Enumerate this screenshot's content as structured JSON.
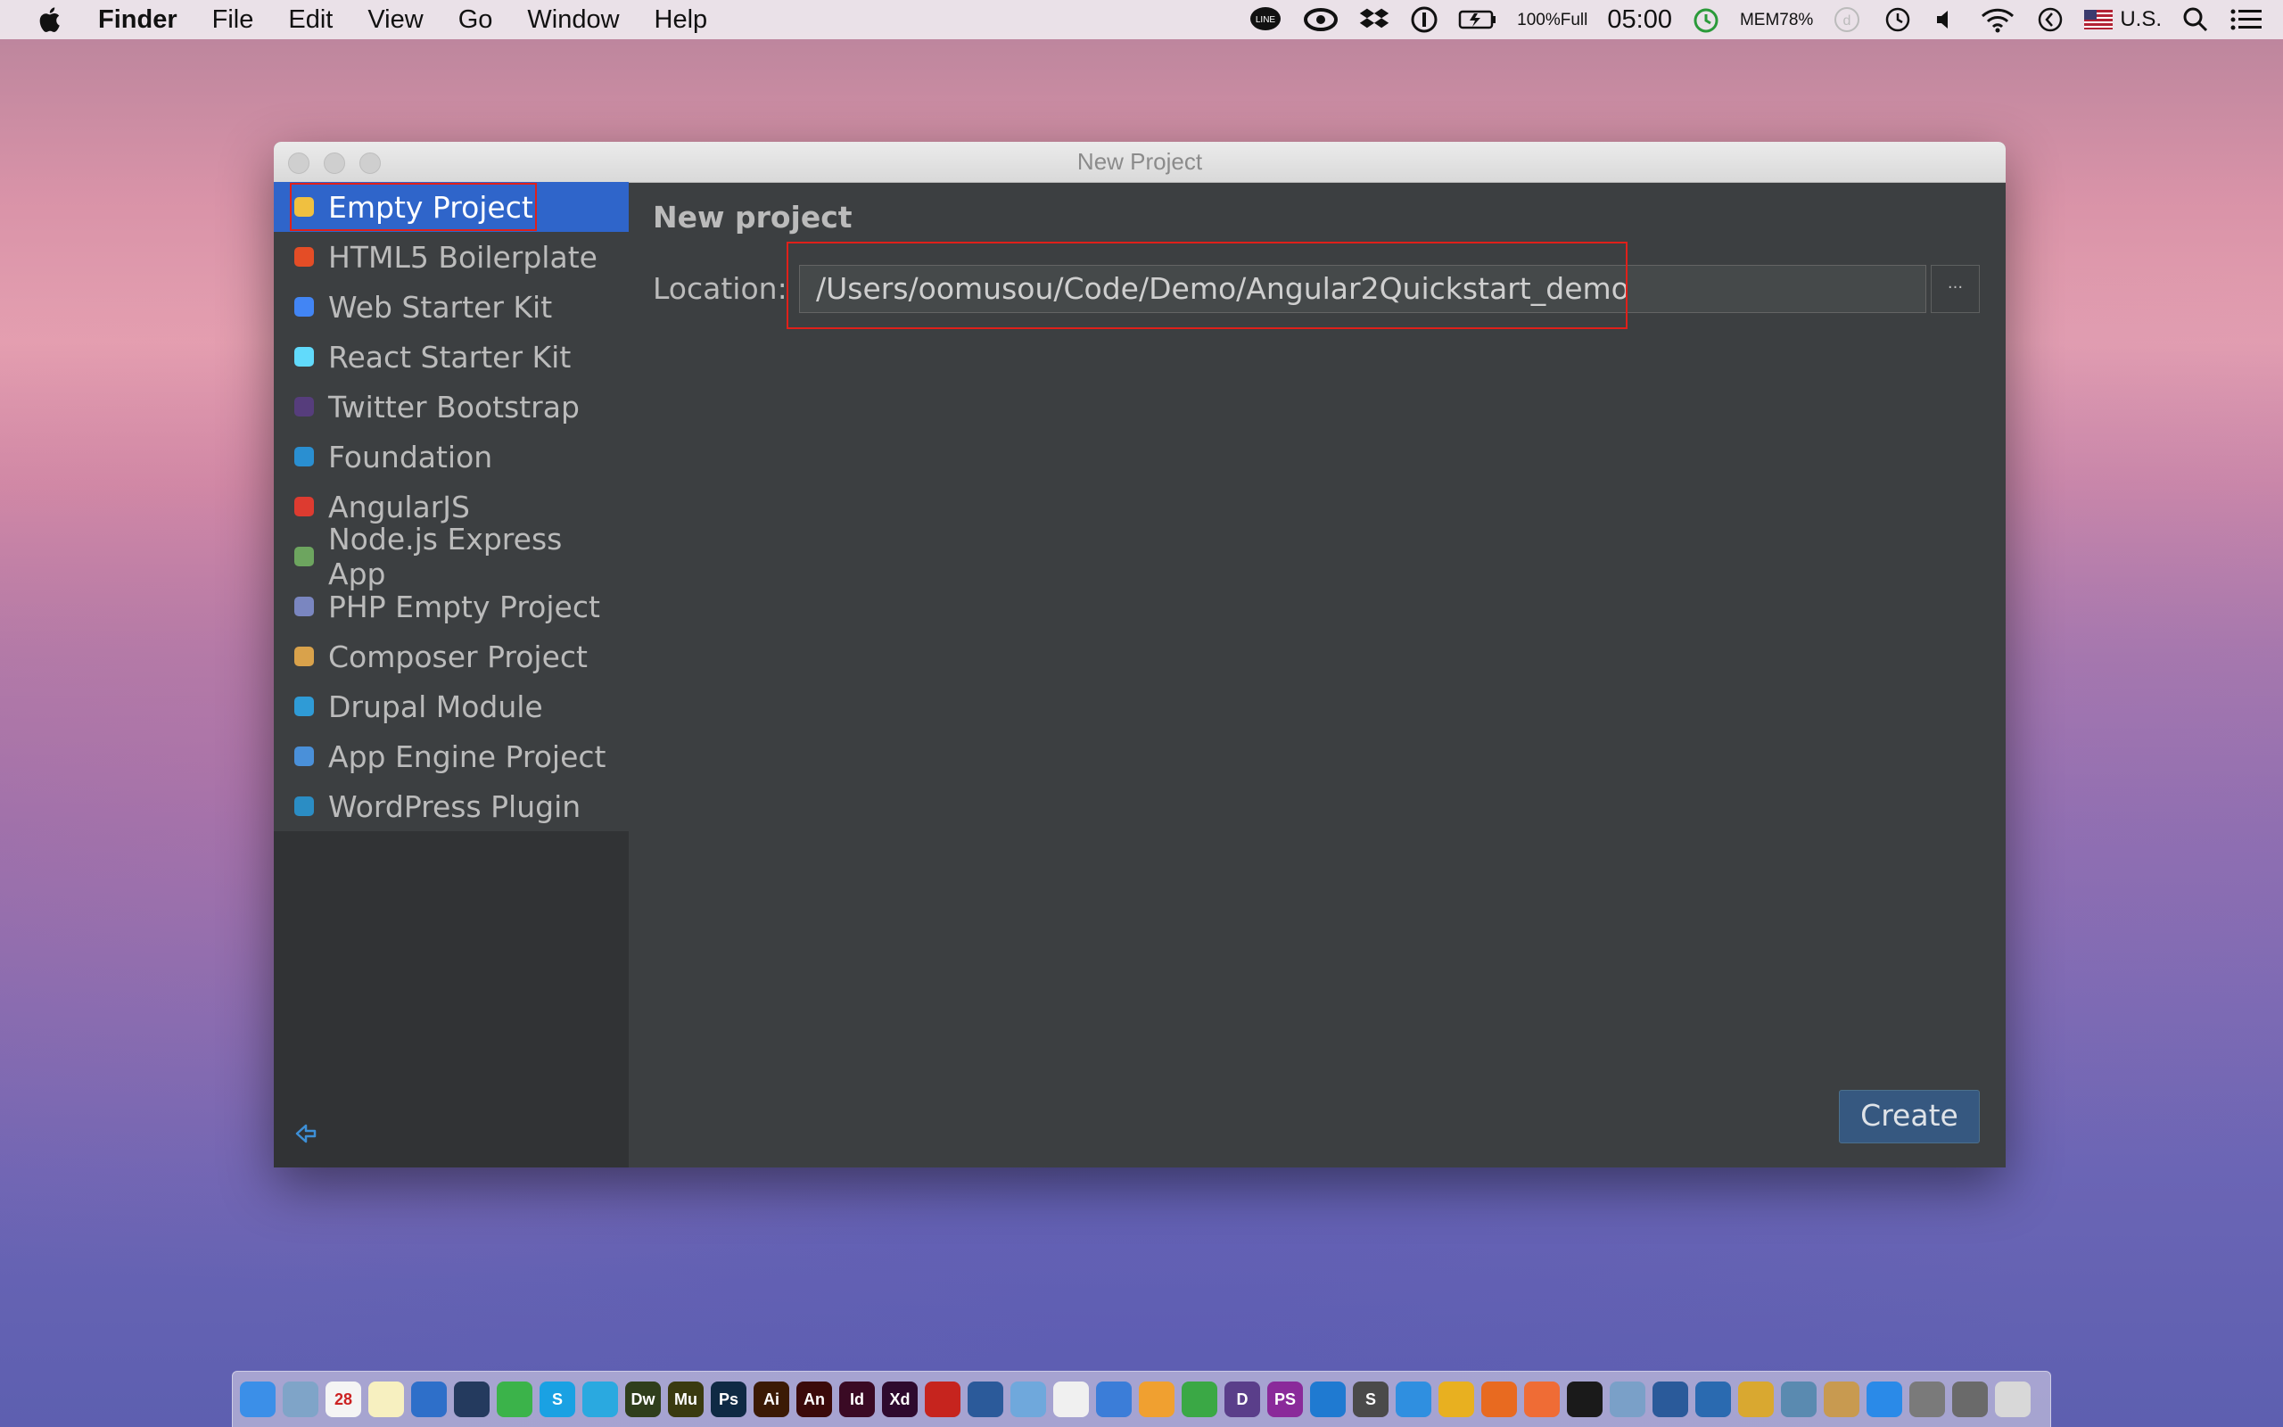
{
  "menubar": {
    "app_name": "Finder",
    "items": [
      "File",
      "Edit",
      "View",
      "Go",
      "Window",
      "Help"
    ],
    "status": {
      "battery_percent": "100%",
      "battery_state": "Full",
      "clock": "05:00",
      "mem_label": "MEM",
      "mem_value": "78%",
      "input_source": "U.S."
    }
  },
  "window": {
    "title": "New Project",
    "project_types": [
      {
        "label": "Empty Project",
        "icon": "empty-project-icon",
        "color": "#f0c040"
      },
      {
        "label": "HTML5 Boilerplate",
        "icon": "html5-icon",
        "color": "#e44d26"
      },
      {
        "label": "Web Starter Kit",
        "icon": "web-starter-kit-icon",
        "color": "#4285f4"
      },
      {
        "label": "React Starter Kit",
        "icon": "react-icon",
        "color": "#61dafb"
      },
      {
        "label": "Twitter Bootstrap",
        "icon": "bootstrap-icon",
        "color": "#563d7c"
      },
      {
        "label": "Foundation",
        "icon": "foundation-icon",
        "color": "#2a8fd1"
      },
      {
        "label": "AngularJS",
        "icon": "angularjs-icon",
        "color": "#dd3b30"
      },
      {
        "label": "Node.js Express App",
        "icon": "nodejs-icon",
        "color": "#6da55f"
      },
      {
        "label": "PHP Empty Project",
        "icon": "php-icon",
        "color": "#7a86c0"
      },
      {
        "label": "Composer Project",
        "icon": "folder-icon",
        "color": "#d9a24b"
      },
      {
        "label": "Drupal Module",
        "icon": "drupal-icon",
        "color": "#2f9bd6"
      },
      {
        "label": "App Engine Project",
        "icon": "app-engine-icon",
        "color": "#4a90d9"
      },
      {
        "label": "WordPress Plugin",
        "icon": "wordpress-icon",
        "color": "#2b8dc4"
      }
    ],
    "selected_index": 0,
    "panel_title": "New project",
    "location_label": "Location:",
    "location_value": "/Users/oomusou/Code/Demo/Angular2Quickstart_demo",
    "browse_label": "...",
    "create_label": "Create"
  },
  "dock": {
    "apps": [
      {
        "name": "finder",
        "text": "",
        "color": "#3b8fe8"
      },
      {
        "name": "preview",
        "text": "",
        "color": "#7fa4c8"
      },
      {
        "name": "calendar",
        "text": "28",
        "color": "#f4f4f4"
      },
      {
        "name": "notes",
        "text": "",
        "color": "#f7f0c0"
      },
      {
        "name": "1password",
        "text": "",
        "color": "#2e6fc9"
      },
      {
        "name": "kindle",
        "text": "",
        "color": "#243a5e"
      },
      {
        "name": "line",
        "text": "",
        "color": "#3bb34a"
      },
      {
        "name": "skype",
        "text": "S",
        "color": "#1aa1e3"
      },
      {
        "name": "twitter",
        "text": "",
        "color": "#2aa9e0"
      },
      {
        "name": "dreamweaver",
        "text": "Dw",
        "color": "#2f3e1c"
      },
      {
        "name": "muse",
        "text": "Mu",
        "color": "#3a3a10"
      },
      {
        "name": "photoshop",
        "text": "Ps",
        "color": "#0f2a44"
      },
      {
        "name": "illustrator",
        "text": "Ai",
        "color": "#3b1a05"
      },
      {
        "name": "animate",
        "text": "An",
        "color": "#3b0a0a"
      },
      {
        "name": "indesign",
        "text": "Id",
        "color": "#3a0a24"
      },
      {
        "name": "xd",
        "text": "Xd",
        "color": "#2e0a2e"
      },
      {
        "name": "acrobat",
        "text": "",
        "color": "#c6241e"
      },
      {
        "name": "screenflow",
        "text": "",
        "color": "#2b5a9a"
      },
      {
        "name": "photos-app",
        "text": "",
        "color": "#6fa8dc"
      },
      {
        "name": "itunes",
        "text": "",
        "color": "#f0f0f0"
      },
      {
        "name": "keynote",
        "text": "",
        "color": "#3b7dd8"
      },
      {
        "name": "pages",
        "text": "",
        "color": "#f0a030"
      },
      {
        "name": "numbers",
        "text": "",
        "color": "#3aa845"
      },
      {
        "name": "dash",
        "text": "D",
        "color": "#5a3e8a"
      },
      {
        "name": "phpstorm",
        "text": "PS",
        "color": "#8a2a9a"
      },
      {
        "name": "vscode",
        "text": "",
        "color": "#1f7ad1"
      },
      {
        "name": "sublime",
        "text": "S",
        "color": "#4a4a4a"
      },
      {
        "name": "safari",
        "text": "",
        "color": "#2f8fe0"
      },
      {
        "name": "chrome",
        "text": "",
        "color": "#e8b020"
      },
      {
        "name": "firefox",
        "text": "",
        "color": "#e86a20"
      },
      {
        "name": "postman",
        "text": "",
        "color": "#ef6c35"
      },
      {
        "name": "terminal",
        "text": "",
        "color": "#1a1a1a"
      },
      {
        "name": "transmit",
        "text": "",
        "color": "#7aa0c8"
      },
      {
        "name": "virtualbox",
        "text": "",
        "color": "#2a5a9a"
      },
      {
        "name": "source-tree",
        "text": "",
        "color": "#2a6ab0"
      },
      {
        "name": "coins",
        "text": "",
        "color": "#d9a830"
      },
      {
        "name": "github-desktop",
        "text": "",
        "color": "#5a8ab0"
      },
      {
        "name": "archive",
        "text": "",
        "color": "#c89a50"
      },
      {
        "name": "app-store",
        "text": "",
        "color": "#2a8ae8"
      },
      {
        "name": "system-preferences",
        "text": "",
        "color": "#7a7a7a"
      },
      {
        "name": "downloads",
        "text": "",
        "color": "#6a6a6a"
      },
      {
        "name": "trash",
        "text": "",
        "color": "#d8d8d8"
      }
    ]
  }
}
